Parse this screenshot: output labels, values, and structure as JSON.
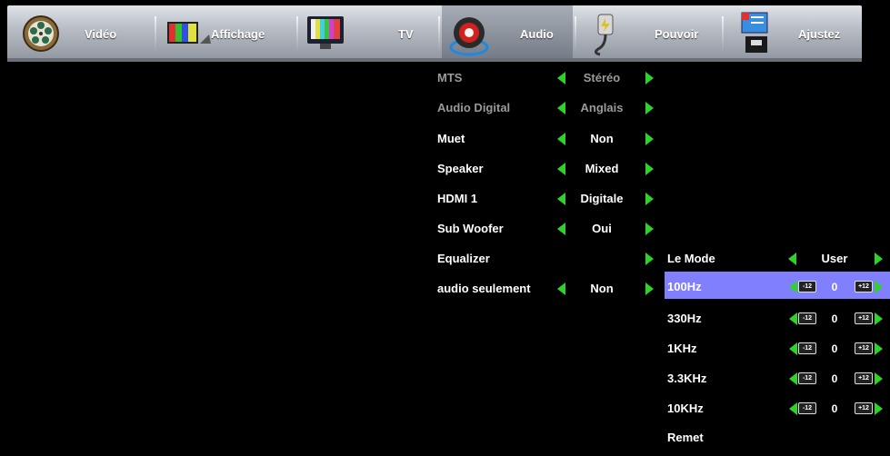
{
  "tabs": [
    {
      "label": "Vidéo",
      "icon": "film-reel-icon"
    },
    {
      "label": "Affichage",
      "icon": "display-icon"
    },
    {
      "label": "TV",
      "icon": "tv-icon"
    },
    {
      "label": "Audio",
      "icon": "speaker-icon"
    },
    {
      "label": "Pouvoir",
      "icon": "power-plug-icon"
    },
    {
      "label": "Ajustez",
      "icon": "settings-screen-icon"
    }
  ],
  "audio_menu": [
    {
      "label": "MTS",
      "value": "Stéréo"
    },
    {
      "label": "Audio Digital",
      "value": "Anglais"
    },
    {
      "label": "Muet",
      "value": "Non"
    },
    {
      "label": "Speaker",
      "value": "Mixed"
    },
    {
      "label": "HDMI 1",
      "value": "Digitale"
    },
    {
      "label": "Sub Woofer",
      "value": "Oui"
    },
    {
      "label": "Equalizer",
      "value": ""
    },
    {
      "label": "audio seulement",
      "value": "Non"
    }
  ],
  "equalizer": {
    "mode_label": "Le Mode",
    "mode_value": "User",
    "bands": [
      {
        "label": "100Hz",
        "value": "0"
      },
      {
        "label": "330Hz",
        "value": "0"
      },
      {
        "label": "1KHz",
        "value": "0"
      },
      {
        "label": "3.3KHz",
        "value": "0"
      },
      {
        "label": "10KHz",
        "value": "0"
      }
    ],
    "min_label": "-12",
    "max_label": "+12",
    "reset_label": "Remet"
  },
  "colors": {
    "accent": "#2fd12a",
    "selection": "#8080ff"
  }
}
